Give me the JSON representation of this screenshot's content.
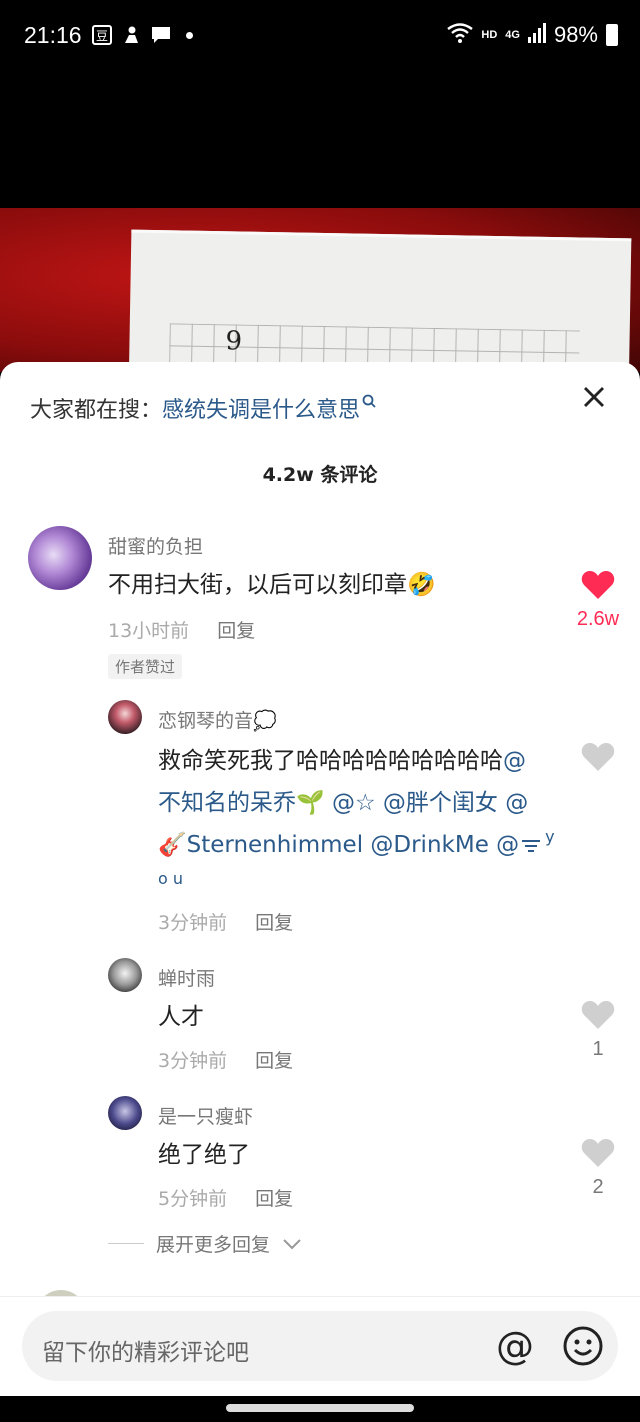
{
  "status_bar": {
    "time": "21:16",
    "network": "HD",
    "signal": "4G",
    "battery": "98%"
  },
  "search_hint": {
    "label": "大家都在搜：",
    "term": "感统失调是什么意思"
  },
  "comment_count": "4.2w 条评论",
  "comments": [
    {
      "name": "甜蜜的负担",
      "text": "不用扫大街，以后可以刻印章🤣",
      "time": "13小时前",
      "reply": "回复",
      "likes": "2.6w",
      "badge": "作者赞过"
    }
  ],
  "replies": [
    {
      "name": "恋钢琴的音💭",
      "text_plain": "救命笑死我了哈哈哈哈哈哈哈哈哈",
      "line1_mention": "@",
      "line2": "不知名的呆乔🌱 @☆ @胖个闺女 @",
      "line3": "🎸Sternenhimmel @DrinkMe @",
      "line4": "o u",
      "y_char": "y",
      "time": "3分钟前",
      "reply": "回复"
    },
    {
      "name": "蝉时雨",
      "text": "人才",
      "time": "3分钟前",
      "reply": "回复",
      "likes": "1"
    },
    {
      "name": "是一只瘦虾",
      "text": "绝了绝了",
      "time": "5分钟前",
      "reply": "回复",
      "likes": "2"
    }
  ],
  "expand_more": "展开更多回复",
  "input": {
    "placeholder": "留下你的精彩评论吧",
    "at_symbol": "@"
  },
  "video": {
    "paper_char": "9"
  },
  "colors": {
    "like_red": "#fe2c55",
    "link_blue": "#2b5a8a"
  }
}
